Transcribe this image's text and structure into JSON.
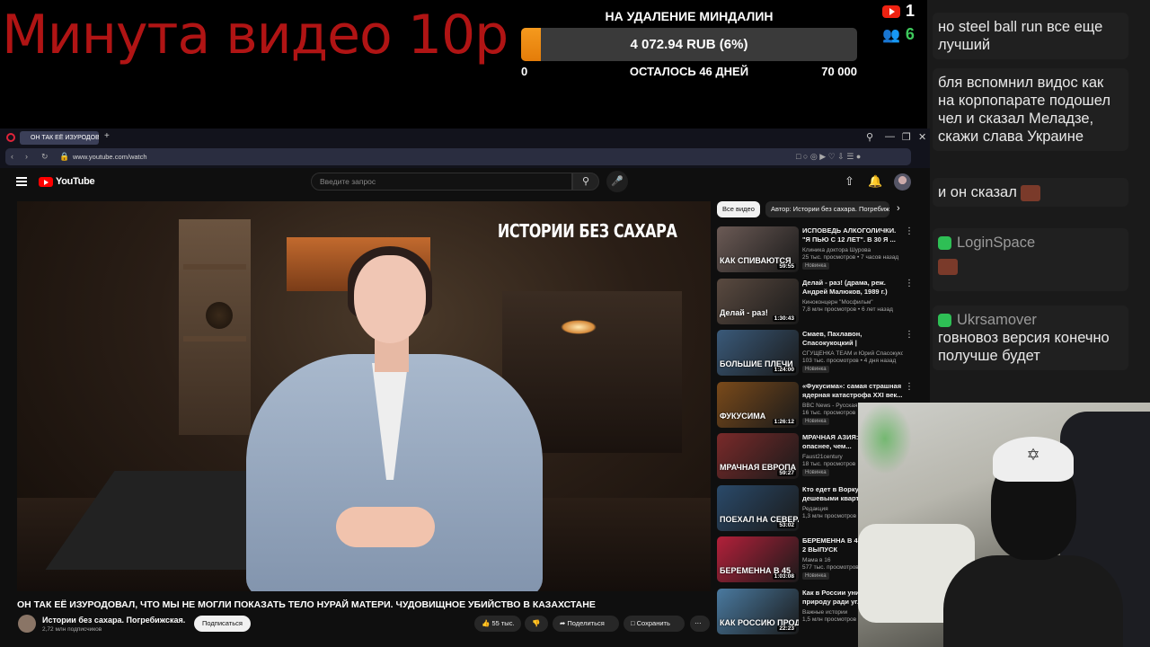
{
  "overlay": {
    "promo_text": "Минута видео 10р",
    "goal_title": "НА УДАЛЕНИЕ МИНДАЛИН",
    "goal_amount": "4 072.94 RUB (6%)",
    "goal_progress_fraction": 0.06,
    "goal_min": "0",
    "goal_remaining": "ОСТАЛОСЬ 46 ДНЕЙ",
    "goal_max": "70 000",
    "youtube_count": "1",
    "viewer_count": "6",
    "accent_orange": "#f08c12",
    "accent_green": "#3ec95c"
  },
  "chat": {
    "messages": [
      {
        "user": "",
        "text": "но steel ball run все еще лучший"
      },
      {
        "user": "",
        "text": "бля вспомнил видос как на корпопарате подошел чел и сказал Меладзе, скажи слава Украине"
      },
      {
        "user": "",
        "text": "и он сказал"
      },
      {
        "user": "LoginSpace",
        "text": ""
      },
      {
        "user": "Ukrsamover",
        "text": "говновоз версия конечно получше будет"
      }
    ]
  },
  "browser": {
    "tab_title": "ОН ТАК ЕЁ ИЗУРОДОВАЛ",
    "url": "www.youtube.com/watch"
  },
  "youtube": {
    "logo_text": "YouTube",
    "search_placeholder": "Введите запрос",
    "video_overlay_brand": "ИСТОРИИ БЕЗ САХАРА",
    "video_title": "ОН ТАК ЕЁ ИЗУРОДОВАЛ, ЧТО МЫ НЕ МОГЛИ ПОКАЗАТЬ ТЕЛО НУРАЙ МАТЕРИ. ЧУДОВИЩНОЕ УБИЙСТВО В КАЗАХСТАНЕ",
    "channel_name": "Истории без сахара. Погребижская.",
    "channel_subs": "2,72 млн подписчиков",
    "subscribe_label": "Подписаться",
    "likes": "55 тыс.",
    "share_label": "Поделиться",
    "save_label": "Сохранить",
    "chips": [
      "Все видео",
      "Автор: Истории без сахара. Погребижская"
    ],
    "recommended": [
      {
        "title": "ИСПОВЕДЬ АЛКОГОЛИЧКИ. \"Я ПЬЮ С 12 ЛЕТ\". В 30 Я ...",
        "channel": "Клиника доктора Шурова",
        "meta": "25 тыс. просмотров • 7 часов назад",
        "badge": "Новинка",
        "duration": "59:55",
        "thumb_label": "КАК СПИВАЮТСЯ",
        "color": "#6b5a55"
      },
      {
        "title": "Делай - раз! (драма, реж. Андрей Малюков, 1989 г.)",
        "channel": "Киноконцерн \"Мосфильм\"",
        "meta": "7,8 млн просмотров • 6 лет назад",
        "badge": "",
        "duration": "1:30:43",
        "thumb_label": "Делай - раз!",
        "color": "#5a4a40"
      },
      {
        "title": "Смаев, Пахлавон, Спасокукоцкий | Тренировка...",
        "channel": "СГУЩЕНКА TEAM и Юрий Спасокукоц...",
        "meta": "103 тыс. просмотров • 4 дня назад",
        "badge": "Новинка",
        "duration": "1:24:00",
        "thumb_label": "БОЛЬШИЕ ПЛЕЧИ",
        "color": "#3a5a7a"
      },
      {
        "title": "«Фукусима»: самая страшная ядерная катастрофа XXI век...",
        "channel": "BBC News - Русская служба",
        "meta": "16 тыс. просмотров",
        "badge": "Новинка",
        "duration": "1:26:12",
        "thumb_label": "ФУКУСИМА",
        "color": "#7a4a1a"
      },
      {
        "title": "МРАЧНАЯ АЗИЯ: здесь опаснее, чем...",
        "channel": "Faust21century",
        "meta": "18 тыс. просмотров",
        "badge": "Новинка",
        "duration": "59:27",
        "thumb_label": "МРАЧНАЯ ЕВРОПА",
        "color": "#7a2a2a"
      },
      {
        "title": "Кто едет в Воркуту за дешевыми квартирами",
        "channel": "Редакция",
        "meta": "1,3 млн просмотров",
        "badge": "",
        "duration": "53:02",
        "thumb_label": "ПОЕХАЛ НА СЕВЕРА",
        "color": "#2a4a6a"
      },
      {
        "title": "БЕРЕМЕННА В 45 | 1 СЕЗОН | 2 ВЫПУСК",
        "channel": "Мама в 16",
        "meta": "577 тыс. просмотров",
        "badge": "Новинка",
        "duration": "1:03:08",
        "thumb_label": "БЕРЕМЕННА В 45",
        "color": "#b3203a"
      },
      {
        "title": "Как в России уничтожают природу ради угля",
        "channel": "Важные истории",
        "meta": "1,5 млн просмотров",
        "badge": "",
        "duration": "22:23",
        "thumb_label": "КАК РОССИЮ ПРОДАЮТ КИТАЮ",
        "color": "#4a7aa0"
      }
    ]
  }
}
